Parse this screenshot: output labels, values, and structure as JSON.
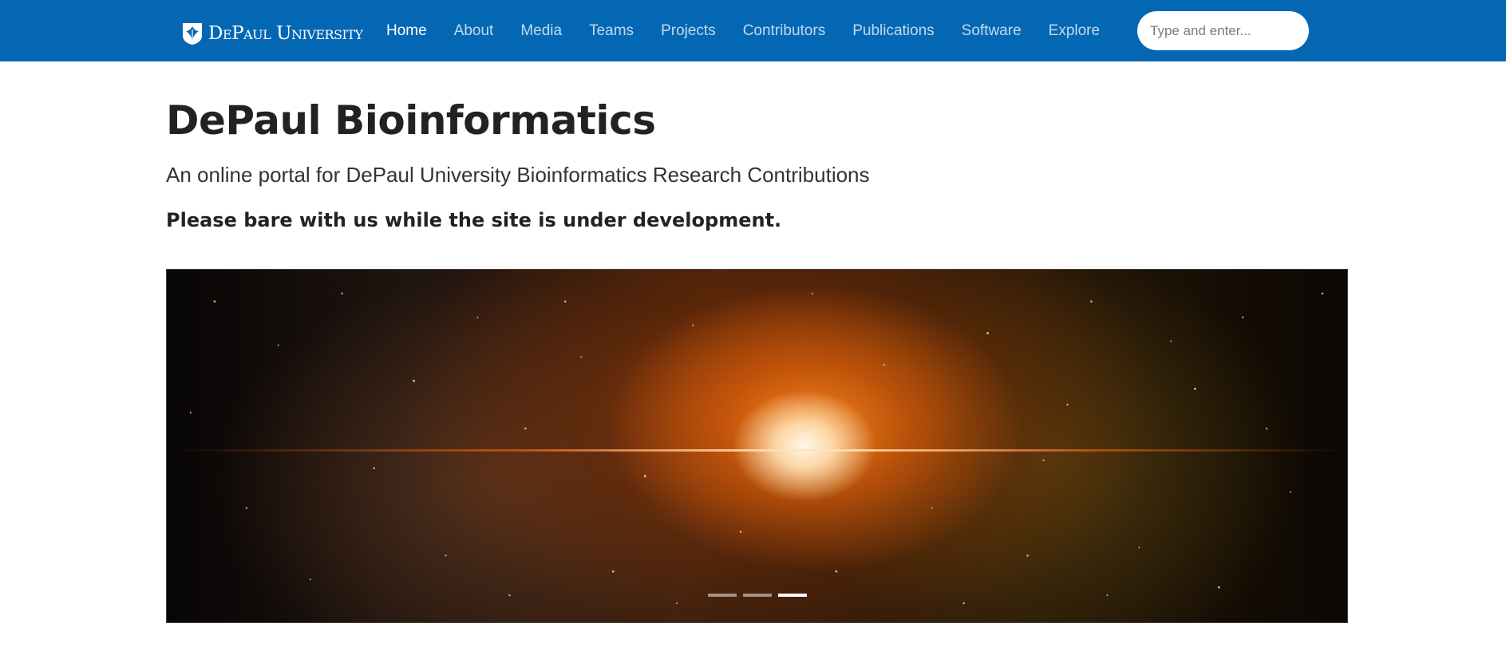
{
  "brand": {
    "name": "DePaul University",
    "icon": "depaul-shield-logo"
  },
  "nav": {
    "items": [
      {
        "label": "Home",
        "active": true
      },
      {
        "label": "About"
      },
      {
        "label": "Media"
      },
      {
        "label": "Teams"
      },
      {
        "label": "Projects"
      },
      {
        "label": "Contributors"
      },
      {
        "label": "Publications"
      },
      {
        "label": "Software"
      },
      {
        "label": "Explore"
      }
    ],
    "search": {
      "placeholder": "Type and enter...",
      "value": ""
    }
  },
  "colors": {
    "navbar": "#0467b3",
    "active_link": "#ffffff"
  },
  "hero": {
    "title": "DePaul Bioinformatics",
    "subtitle": "An online portal for DePaul University Bioinformatics Research Contributions",
    "notice": "Please bare with us while the site is under development."
  },
  "carousel": {
    "image": "orange-nebula-space-image",
    "slide_count": 3,
    "active_slide": 3
  }
}
